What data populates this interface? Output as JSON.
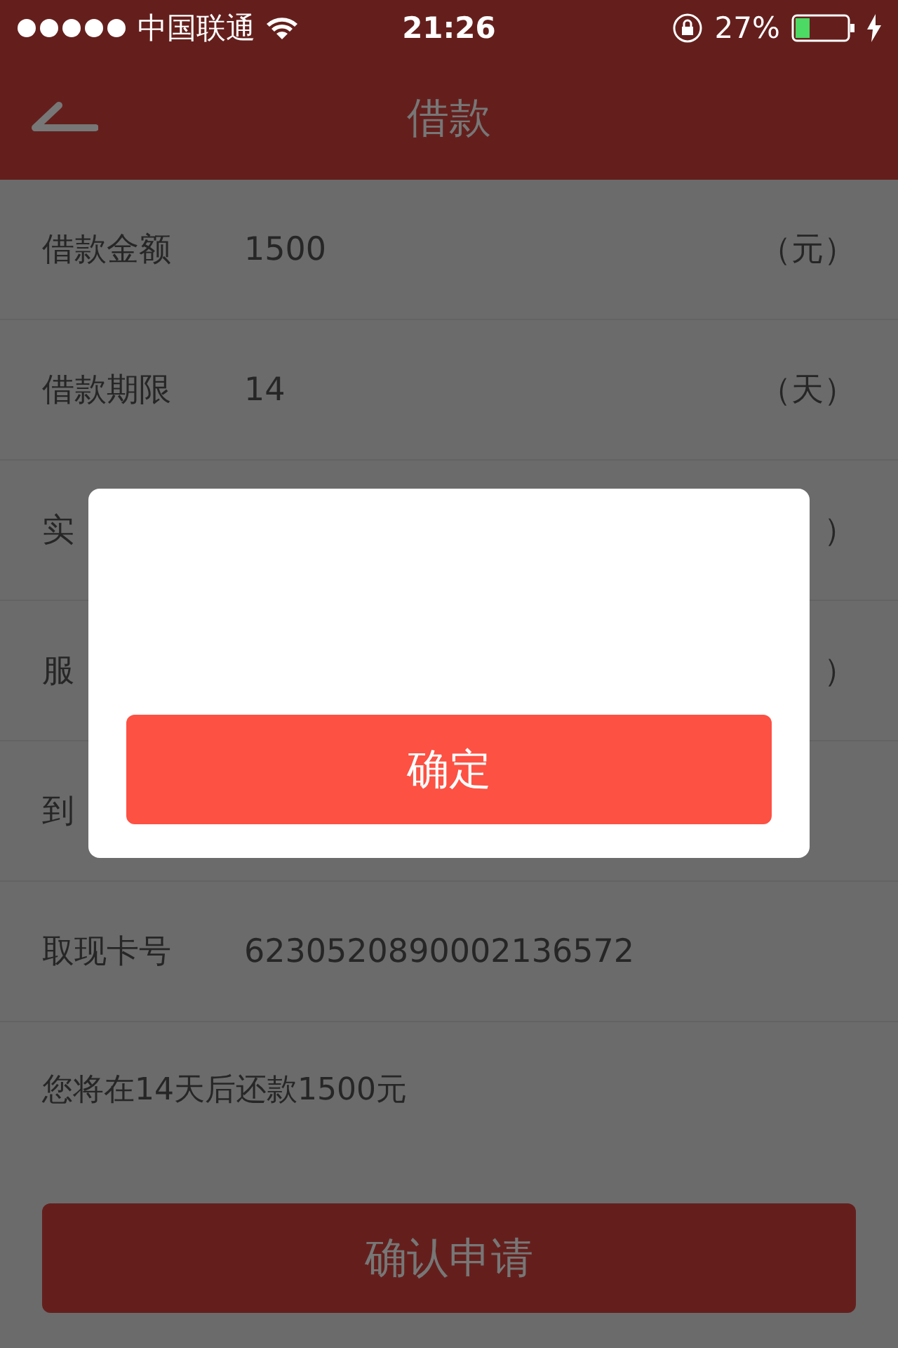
{
  "status_bar": {
    "carrier": "中国联通",
    "time": "21:26",
    "battery": "27%"
  },
  "header": {
    "title": "借款"
  },
  "rows": [
    {
      "label": "借款金额",
      "value": "1500",
      "unit": "（元）"
    },
    {
      "label": "借款期限",
      "value": "14",
      "unit": "（天）"
    },
    {
      "label": "实",
      "unit": "）"
    },
    {
      "label": "服",
      "unit": "）"
    },
    {
      "label": "到"
    },
    {
      "label": "取现卡号",
      "value": "6230520890002136572"
    }
  ],
  "note": "您将在14天后还款1500元",
  "submit_button": "确认申请",
  "dialog": {
    "button": "确定"
  }
}
